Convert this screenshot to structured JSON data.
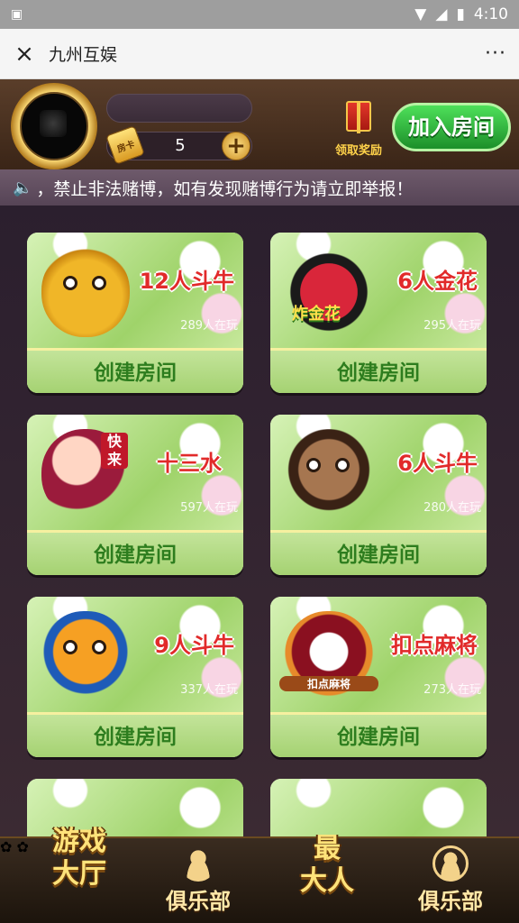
{
  "statusbar": {
    "time": "4:10",
    "left_icon": "image-icon",
    "icons": [
      "wifi-icon",
      "signal-icon",
      "battery-icon"
    ]
  },
  "titlebar": {
    "title": "九州互娱",
    "close_icon": "×",
    "more_icon": "···"
  },
  "header": {
    "card_label": "房卡",
    "card_count": "5",
    "plus_label": "+",
    "gift_label": "领取奖励",
    "join_label": "加入房间"
  },
  "notice": {
    "speaker_icon": "🔈",
    "text": "，禁止非法赌博，如有发现赌博行为请立即举报！"
  },
  "games": [
    {
      "name": "12人斗牛",
      "players": "289人在玩",
      "button": "创建房间",
      "char_icon": "ox-mascot-icon"
    },
    {
      "name": "6人金花",
      "players": "295人在玩",
      "button": "创建房间",
      "char_icon": "poker-chips-icon",
      "art_text": "炸金花"
    },
    {
      "name": "十三水",
      "players": "597人在玩",
      "button": "创建房间",
      "char_icon": "girl-mascot-icon",
      "art_text": "快来"
    },
    {
      "name": "6人斗牛",
      "players": "280人在玩",
      "button": "创建房间",
      "char_icon": "cow-mascot-icon"
    },
    {
      "name": "9人斗牛",
      "players": "337人在玩",
      "button": "创建房间",
      "char_icon": "calf-mascot-icon"
    },
    {
      "name": "扣点麻将",
      "players": "273人在玩",
      "button": "创建房间",
      "char_icon": "mahjong-icon",
      "art_text": "扣点麻将"
    }
  ],
  "bottomnav": {
    "lobby_line1": "游戏",
    "lobby_line2": "大厅",
    "club1_label": "俱乐部",
    "center_line1": "最",
    "center_line2": "大人",
    "club2_label": "俱乐部"
  }
}
